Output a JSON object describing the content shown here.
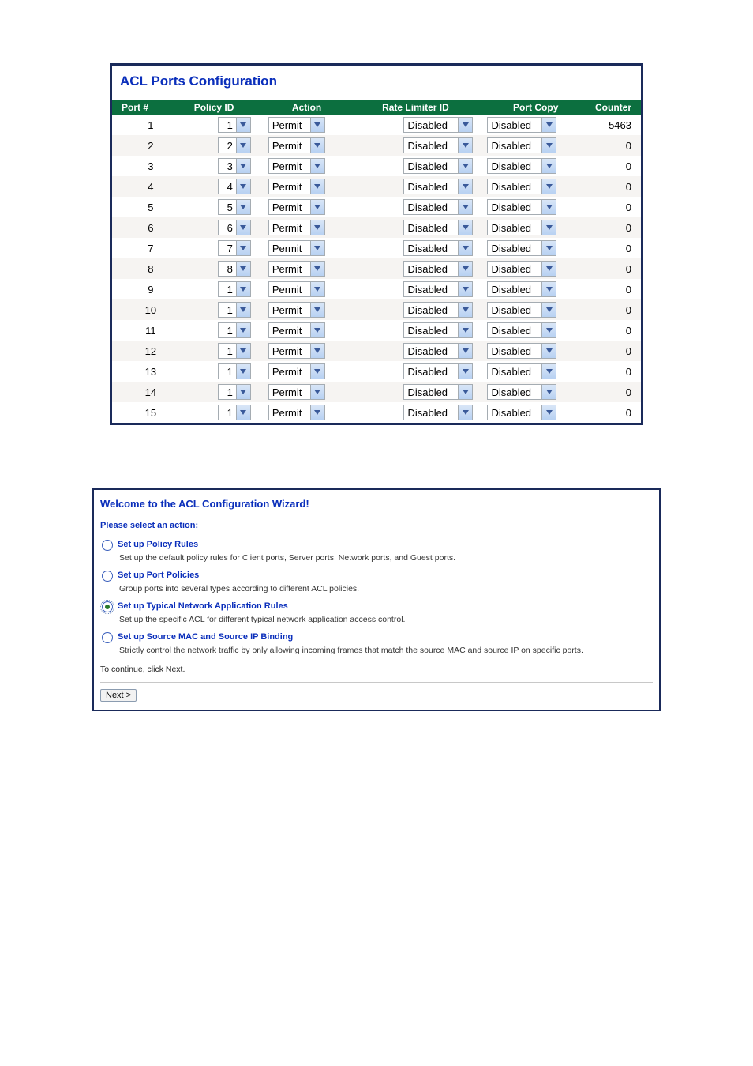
{
  "acl_panel": {
    "title": "ACL Ports Configuration",
    "columns": {
      "port": "Port #",
      "policy": "Policy ID",
      "action": "Action",
      "rate": "Rate Limiter ID",
      "copy": "Port Copy",
      "counter": "Counter"
    },
    "rows": [
      {
        "port": "1",
        "policy": "1",
        "action": "Permit",
        "rate": "Disabled",
        "copy": "Disabled",
        "counter": "5463"
      },
      {
        "port": "2",
        "policy": "2",
        "action": "Permit",
        "rate": "Disabled",
        "copy": "Disabled",
        "counter": "0"
      },
      {
        "port": "3",
        "policy": "3",
        "action": "Permit",
        "rate": "Disabled",
        "copy": "Disabled",
        "counter": "0"
      },
      {
        "port": "4",
        "policy": "4",
        "action": "Permit",
        "rate": "Disabled",
        "copy": "Disabled",
        "counter": "0"
      },
      {
        "port": "5",
        "policy": "5",
        "action": "Permit",
        "rate": "Disabled",
        "copy": "Disabled",
        "counter": "0"
      },
      {
        "port": "6",
        "policy": "6",
        "action": "Permit",
        "rate": "Disabled",
        "copy": "Disabled",
        "counter": "0"
      },
      {
        "port": "7",
        "policy": "7",
        "action": "Permit",
        "rate": "Disabled",
        "copy": "Disabled",
        "counter": "0"
      },
      {
        "port": "8",
        "policy": "8",
        "action": "Permit",
        "rate": "Disabled",
        "copy": "Disabled",
        "counter": "0"
      },
      {
        "port": "9",
        "policy": "1",
        "action": "Permit",
        "rate": "Disabled",
        "copy": "Disabled",
        "counter": "0"
      },
      {
        "port": "10",
        "policy": "1",
        "action": "Permit",
        "rate": "Disabled",
        "copy": "Disabled",
        "counter": "0"
      },
      {
        "port": "11",
        "policy": "1",
        "action": "Permit",
        "rate": "Disabled",
        "copy": "Disabled",
        "counter": "0"
      },
      {
        "port": "12",
        "policy": "1",
        "action": "Permit",
        "rate": "Disabled",
        "copy": "Disabled",
        "counter": "0"
      },
      {
        "port": "13",
        "policy": "1",
        "action": "Permit",
        "rate": "Disabled",
        "copy": "Disabled",
        "counter": "0"
      },
      {
        "port": "14",
        "policy": "1",
        "action": "Permit",
        "rate": "Disabled",
        "copy": "Disabled",
        "counter": "0"
      },
      {
        "port": "15",
        "policy": "1",
        "action": "Permit",
        "rate": "Disabled",
        "copy": "Disabled",
        "counter": "0"
      }
    ]
  },
  "wizard": {
    "title": "Welcome to the ACL Configuration Wizard!",
    "subtitle": "Please select an action:",
    "options": [
      {
        "label": "Set up Policy Rules",
        "desc": "Set up the default policy rules for Client ports, Server ports, Network ports, and Guest ports.",
        "checked": false
      },
      {
        "label": "Set up Port Policies",
        "desc": "Group ports into several types according to different ACL policies.",
        "checked": false
      },
      {
        "label": "Set up Typical Network Application Rules",
        "desc": "Set up the specific ACL for different typical network application access control.",
        "checked": true
      },
      {
        "label": "Set up Source MAC and Source IP Binding",
        "desc": "Strictly control the network traffic by only allowing incoming frames that match the source MAC and source IP on specific ports.",
        "checked": false
      }
    ],
    "continue_text": "To continue, click Next.",
    "next_label": "Next >"
  }
}
